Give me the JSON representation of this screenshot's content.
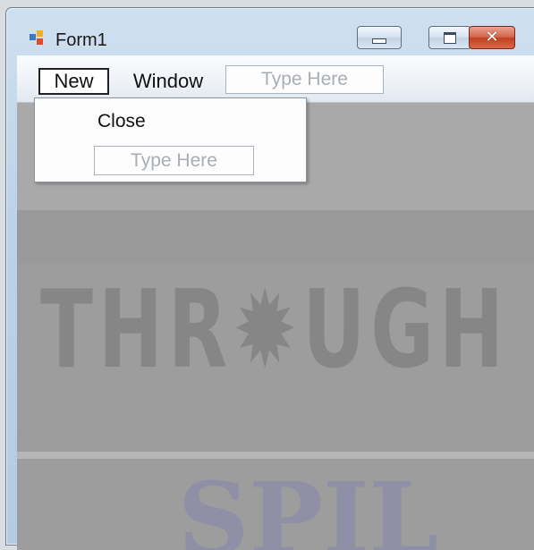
{
  "window": {
    "title": "Form1",
    "icon": "form-app-icon",
    "controls": {
      "minimize": "minimize-icon",
      "maximize": "maximize-icon",
      "close": "✕"
    }
  },
  "menu": {
    "items": [
      {
        "label": "New",
        "active": true
      },
      {
        "label": "Window"
      }
    ],
    "type_here": "Type Here"
  },
  "dropdown": {
    "items": [
      {
        "label": "Close"
      }
    ],
    "type_here": "Type Here"
  },
  "watermark": {
    "line1": "THR✹UGH TE",
    "line2": "SPIL"
  },
  "colors": {
    "title_bar": "#bcd2e8",
    "close_button": "#c7472a",
    "client_area": "#9d9d9d"
  }
}
